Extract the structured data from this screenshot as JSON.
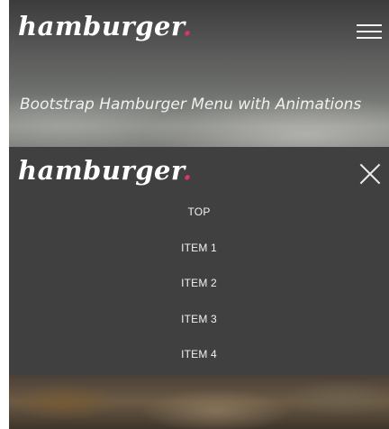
{
  "header": {
    "logo_text": "hamburger",
    "logo_dot": ".",
    "menu_icon": "hamburger-menu-icon"
  },
  "hero": {
    "tagline": "Bootstrap Hamburger Menu with Animations"
  },
  "menu": {
    "logo_text": "hamburger",
    "logo_dot": ".",
    "close_icon": "close-icon",
    "items": [
      {
        "label": "TOP"
      },
      {
        "label": "ITEM 1"
      },
      {
        "label": "ITEM 2"
      },
      {
        "label": "ITEM 3"
      },
      {
        "label": "ITEM 4"
      }
    ]
  },
  "colors": {
    "accent_dot": "#d9346b",
    "menu_background": "#404040",
    "text": "#ffffff"
  }
}
